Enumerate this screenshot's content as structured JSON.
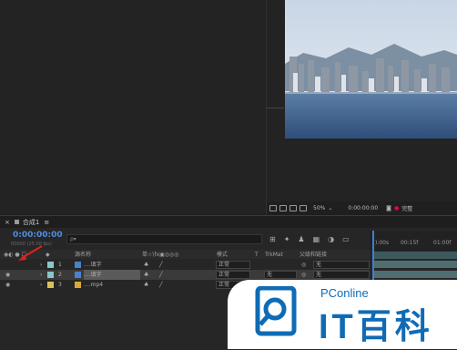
{
  "viewer": {
    "zoom": "50%",
    "timecode": "0:00:00:00",
    "complete_label": "完整"
  },
  "timeline": {
    "tab_label": "合成1",
    "tab_menu": "≡",
    "current_time": "0:00:00:00",
    "fps_label": "00000 (25.00 fps)",
    "search_placeholder": "ρ▾",
    "headers": {
      "source_name": "源名称",
      "switches": "单☆\\fx▣◎◎◎",
      "mode": "模式",
      "t": "T",
      "trkmat": "TrkMat",
      "parent": "父级和链接"
    },
    "ruler_labels": [
      "):00s",
      "00:15f",
      "01:00f"
    ],
    "layers": [
      {
        "num": "1",
        "name": "....填字",
        "mode": "正常",
        "trkmat": "",
        "parent": "无",
        "color": "#8ac6c9",
        "selected": false
      },
      {
        "num": "2",
        "name": "....填字",
        "mode": "正常",
        "trkmat": "无",
        "parent": "无",
        "color": "#8ac6c9",
        "selected": true
      },
      {
        "num": "3",
        "name": "....mp4",
        "mode": "正常",
        "trkmat": "无",
        "parent": "无",
        "color": "#d8c25a",
        "selected": false
      }
    ]
  },
  "watermark": {
    "small_text": "PConline",
    "big_text": "IT百科",
    "color": "#0f6bb5"
  }
}
